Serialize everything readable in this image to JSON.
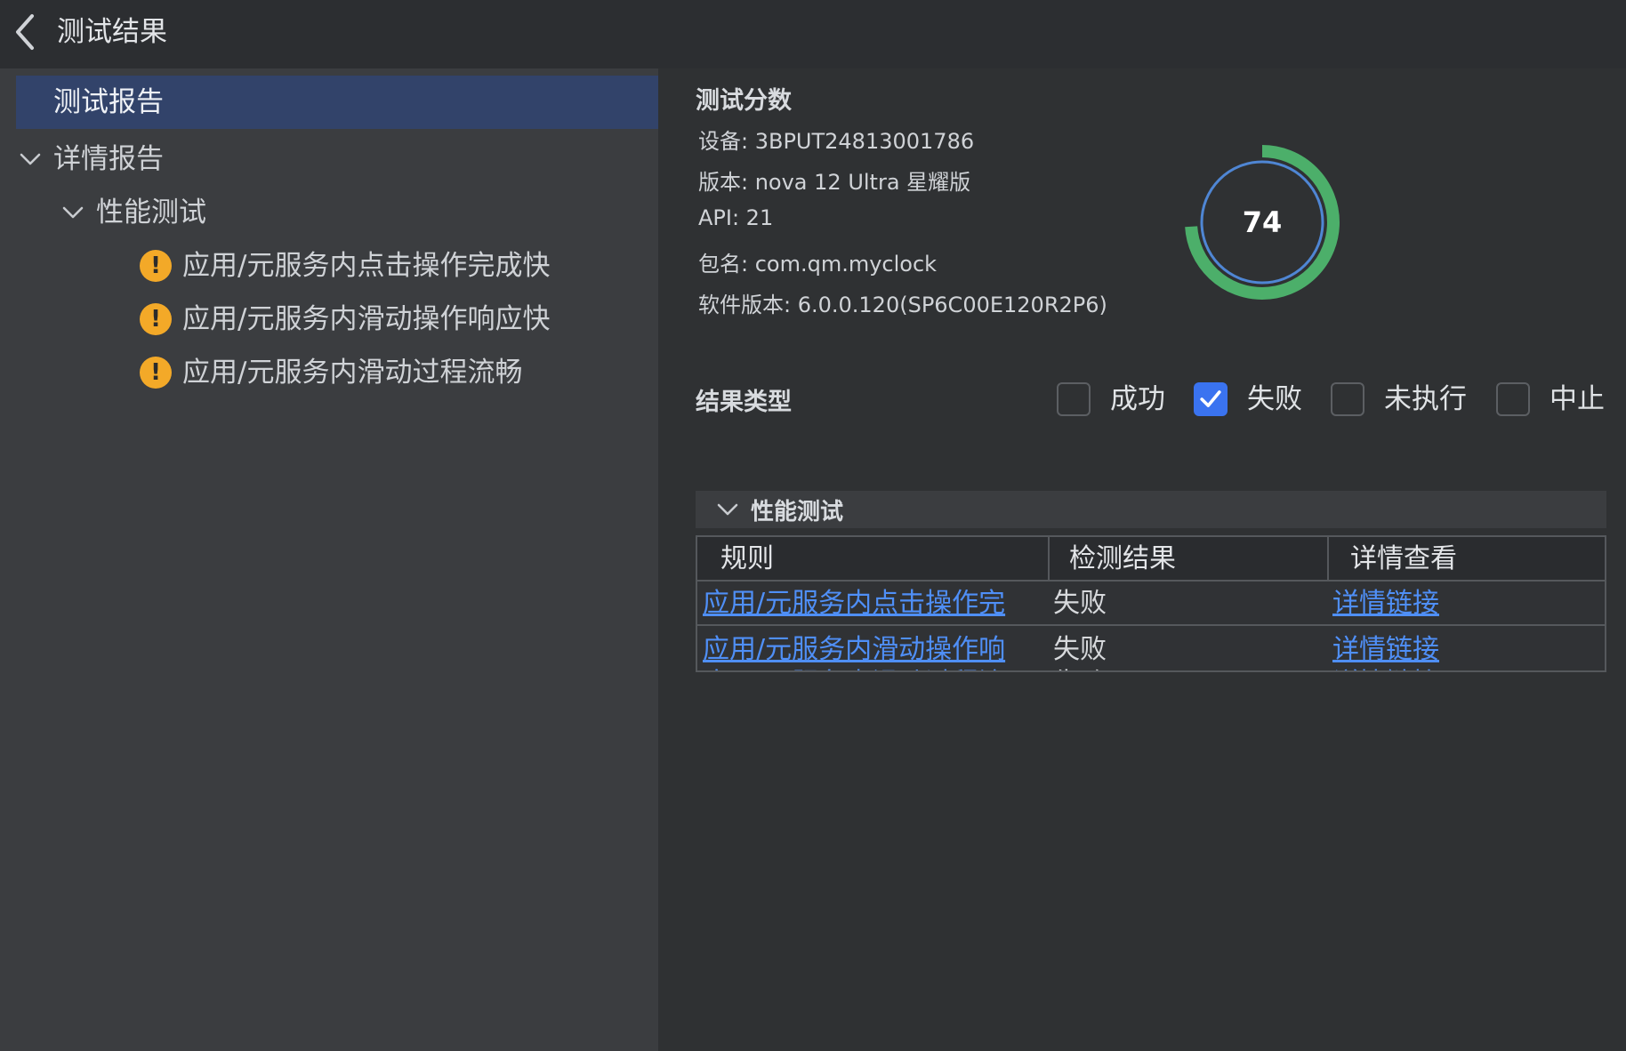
{
  "window": {
    "title": "测试结果"
  },
  "sidebar": {
    "items": [
      {
        "label": "测试报告"
      },
      {
        "label": "详情报告"
      },
      {
        "label": "性能测试"
      },
      {
        "label": "应用/元服务内点击操作完成快"
      },
      {
        "label": "应用/元服务内滑动操作响应快"
      },
      {
        "label": "应用/元服务内滑动过程流畅"
      }
    ],
    "warn_glyph": "!"
  },
  "score": {
    "section_title": "测试分数",
    "value": "74",
    "info": [
      "设备: 3BPUT24813001786",
      "版本: nova 12 Ultra 星耀版",
      "API: 21",
      "包名: com.qm.myclock",
      "软件版本: 6.0.0.120(SP6C00E120R2P6)"
    ],
    "ring_fraction": 0.74,
    "ring_color": "#4caf6a",
    "inner_ring_color": "#4f86d4"
  },
  "filters": {
    "title": "结果类型",
    "options": [
      {
        "label": "成功",
        "checked": false
      },
      {
        "label": "失败",
        "checked": true
      },
      {
        "label": "未执行",
        "checked": false
      },
      {
        "label": "中止",
        "checked": false
      }
    ]
  },
  "results": {
    "group_label": "性能测试",
    "headers": [
      "规则",
      "检测结果",
      "详情查看"
    ],
    "rows": [
      {
        "rule": "应用/元服务内点击操作完",
        "result": "失败",
        "link": "详情链接"
      },
      {
        "rule": "应用/元服务内滑动操作响",
        "result": "失败",
        "link": "详情链接"
      },
      {
        "rule": "应用/元服务内滑动过程流",
        "result": "失败",
        "link": "详情链接"
      }
    ]
  },
  "colors": {
    "accent": "#3a73f0",
    "link": "#4f8ff7",
    "warning": "#f3a928",
    "selected_bg": "#32436a"
  }
}
